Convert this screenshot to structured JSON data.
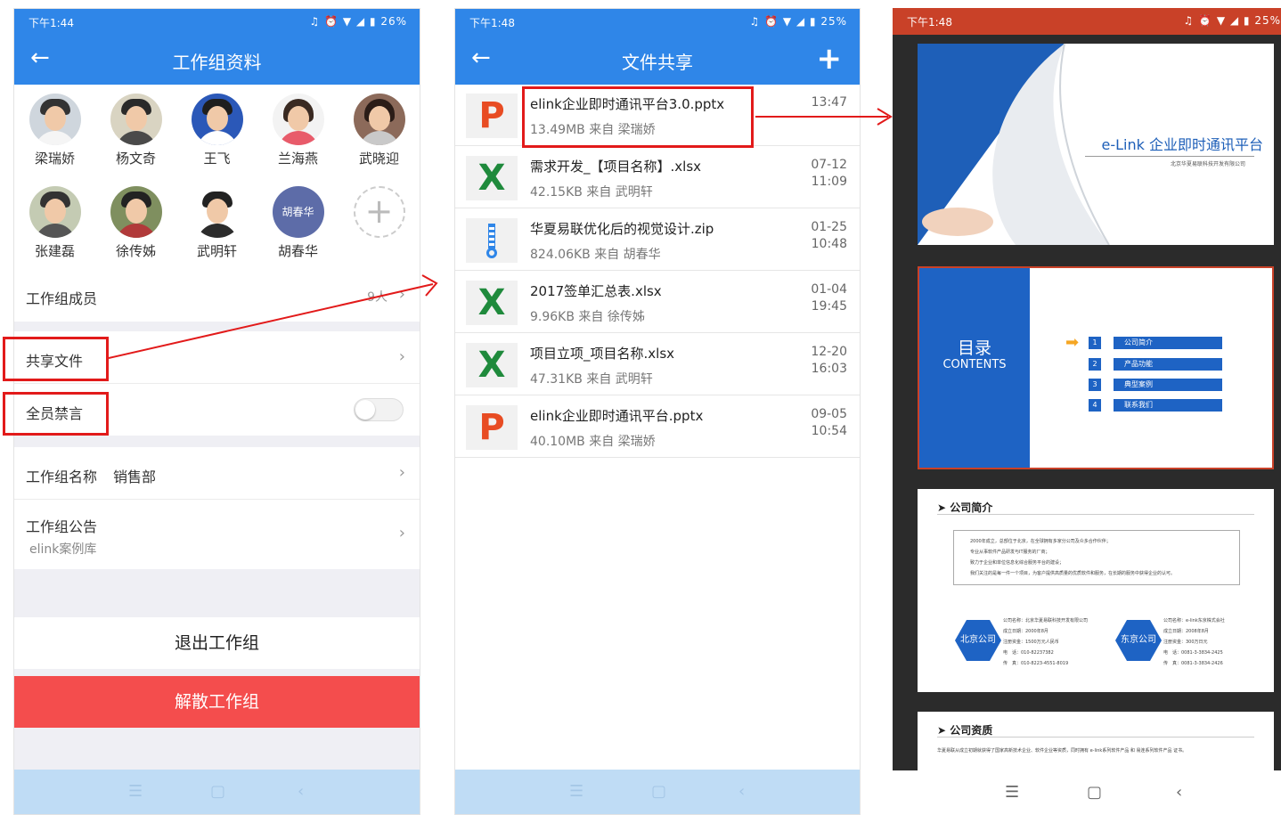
{
  "colors": {
    "primary": "#2f86e8",
    "danger": "#f44d4d",
    "highlight": "#e21a1a",
    "ppt": "#e84c23",
    "excel": "#1f8a3c"
  },
  "screen1": {
    "status": {
      "time": "下午1:44",
      "right": "♫ ⏰ ▼ ◢ ▮ 26%"
    },
    "title": "工作组资料",
    "members": [
      {
        "name": "梁瑞娇"
      },
      {
        "name": "杨文奇"
      },
      {
        "name": "王飞"
      },
      {
        "name": "兰海燕"
      },
      {
        "name": "武晓迎"
      },
      {
        "name": "张建磊"
      },
      {
        "name": "徐传姊"
      },
      {
        "name": "武明轩"
      },
      {
        "name": "胡春华",
        "avatar_text": "胡春华"
      }
    ],
    "member_row": {
      "label": "工作组成员",
      "count": "9人"
    },
    "share_files": "共享文件",
    "mute_all": "全员禁言",
    "group_name": {
      "label": "工作组名称",
      "value": "销售部"
    },
    "notice": {
      "label": "工作组公告",
      "value": "elink案例库"
    },
    "exit": "退出工作组",
    "dissolve": "解散工作组"
  },
  "screen2": {
    "status": {
      "time": "下午1:48",
      "right": "♫ ⏰ ▼ ◢ ▮ 25%"
    },
    "title": "文件共享",
    "files": [
      {
        "type": "ppt",
        "name": "elink企业即时通讯平台3.0.pptx",
        "meta": "13.49MB  来自 梁瑞娇",
        "date": "13:47",
        "time": ""
      },
      {
        "type": "excel",
        "name": "需求开发_【项目名称】.xlsx",
        "meta": "42.15KB  来自 武明轩",
        "date": "07-12",
        "time": "11:09"
      },
      {
        "type": "zip",
        "name": "华夏易联优化后的视觉设计.zip",
        "meta": "824.06KB  来自 胡春华",
        "date": "01-25",
        "time": "10:48"
      },
      {
        "type": "excel",
        "name": "2017签单汇总表.xlsx",
        "meta": "9.96KB  来自 徐传姊",
        "date": "01-04",
        "time": "19:45"
      },
      {
        "type": "excel",
        "name": "项目立项_项目名称.xlsx",
        "meta": "47.31KB  来自 武明轩",
        "date": "12-20",
        "time": "16:03"
      },
      {
        "type": "ppt",
        "name": "elink企业即时通讯平台.pptx",
        "meta": "40.10MB  来自 梁瑞娇",
        "date": "09-05",
        "time": "10:54"
      }
    ]
  },
  "screen3": {
    "status": {
      "time": "下午1:48",
      "right": "♫ ⏰ ▼ ◢ ▮ 25%"
    },
    "slide1": {
      "title": "e-Link 企业即时通讯平台",
      "subtitle": "北京华夏易联科技开发有限公司"
    },
    "slide2": {
      "title": "目录",
      "subtitle": "CONTENTS",
      "items": [
        {
          "num": "1",
          "label": "公司简介"
        },
        {
          "num": "2",
          "label": "产品功能"
        },
        {
          "num": "3",
          "label": "典型案例"
        },
        {
          "num": "4",
          "label": "联系我们"
        }
      ]
    },
    "slide3": {
      "heading": "公司简介",
      "bullets": [
        "2000年成立，总部位于北京，在全球拥有多家分公司及众多合作伙伴；",
        "专业从事软件产品研发与IT服务的厂商；",
        "致力于企业和单位信息化综合服务平台的建设；",
        "我们关注的是每一件一个项目，为客户提供高质量的优质软件和服务，在长期的服务中获得企业的认可。"
      ],
      "company_a": {
        "name": "北京公司",
        "lines": [
          "公司名称：北京华夏易联科技开发有限公司",
          "成立日期：2000年8月",
          "注册资金：1500万元人民币",
          "电　话：010-82237382",
          "传　真：010-8223-4551-8019"
        ]
      },
      "company_b": {
        "name": "东京公司",
        "lines": [
          "公司名称：e-link东京株式会社",
          "成立日期：2008年8月",
          "注册资金：300万日元",
          "电　话：0081-3-3834-2425",
          "传　真：0081-3-3834-2426"
        ]
      }
    },
    "slide4": {
      "heading": "公司资质",
      "text": "华夏易联从成立初期就获得了国家高新技术企业、软件企业等资质，同时拥有 e-link系列软件产品 和 易连系列软件产品 证书。"
    }
  },
  "nav": {
    "menu": "☰",
    "home": "▢",
    "back": "‹"
  }
}
